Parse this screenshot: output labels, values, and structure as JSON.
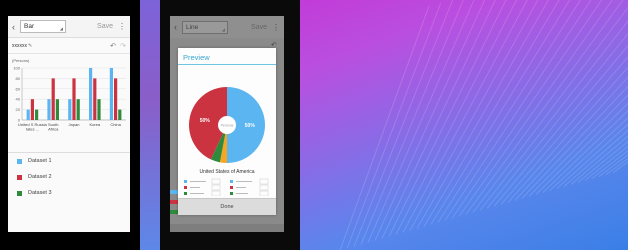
{
  "left_phone": {
    "chart_type_selected": "Bar",
    "save_label": "Save",
    "title_field": "xxxxxx",
    "chart_data": {
      "type": "bar",
      "ylabel": "(Persons)",
      "ylim": [
        0,
        100
      ],
      "yticks": [
        "100",
        "80",
        "60",
        "40",
        "20",
        "0"
      ],
      "categories": [
        "United S Russia tates ...",
        "South Africa",
        "Japan",
        "Korea",
        "China"
      ],
      "series": [
        {
          "name": "Dataset 1",
          "color": "#5bb5f0",
          "values": [
            20,
            40,
            40,
            100,
            100
          ]
        },
        {
          "name": "Dataset 2",
          "color": "#cc3340",
          "values": [
            40,
            80,
            80,
            80,
            80
          ]
        },
        {
          "name": "Dataset 3",
          "color": "#2f8a3c",
          "values": [
            20,
            40,
            40,
            40,
            20
          ]
        }
      ]
    },
    "legend": [
      {
        "label": "Dataset 1",
        "color": "#5bb5f0"
      },
      {
        "label": "Dataset 2",
        "color": "#cc3340"
      },
      {
        "label": "Dataset 3",
        "color": "#2f8a3c"
      }
    ]
  },
  "middle_phone": {
    "chart_type_selected": "Line",
    "save_label": "Save",
    "dialog": {
      "title": "Preview",
      "region": "United States of America",
      "done_label": "Done",
      "chart_data": {
        "type": "pie",
        "center_label": "Persons",
        "slices": [
          {
            "label": "50%",
            "value": 50,
            "color": "#5bb5f0"
          },
          {
            "label": "",
            "value": 3,
            "color": "#f5a623"
          },
          {
            "label": "",
            "value": 4,
            "color": "#2f8a3c"
          },
          {
            "label": "50%",
            "value": 43,
            "color": "#cc3340"
          }
        ]
      }
    }
  }
}
